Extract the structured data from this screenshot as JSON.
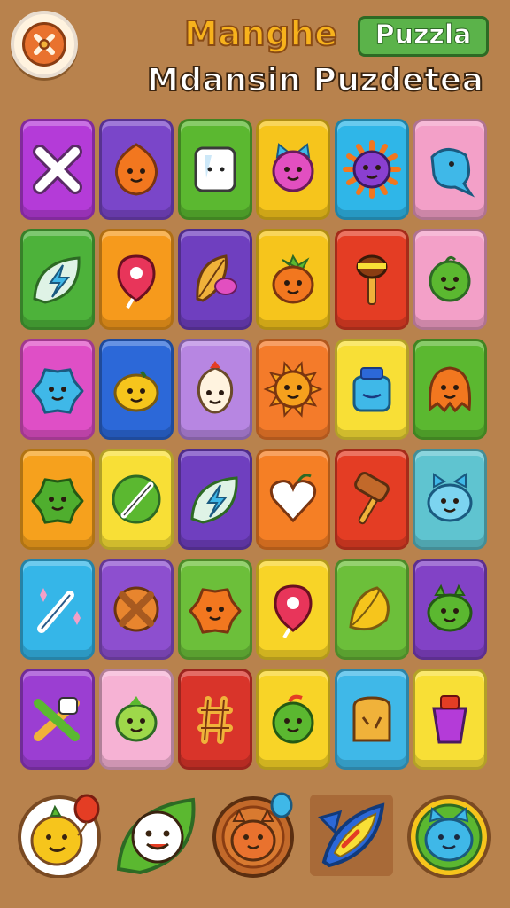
{
  "header": {
    "menu_icon": "paw-icon",
    "title": "Manghe",
    "title_badge": "Puzzla",
    "subtitle": "Mdansin Puzdetea"
  },
  "board": {
    "rows": 6,
    "cols": 6,
    "tiles": [
      [
        {
          "color": "#b43bd8",
          "icon": "cross-bones-icon"
        },
        {
          "color": "#7a46c9",
          "icon": "orange-blob-icon"
        },
        {
          "color": "#5bb830",
          "icon": "white-cube-icon"
        },
        {
          "color": "#f6c51c",
          "icon": "pink-cat-icon"
        },
        {
          "color": "#2fb6e8",
          "icon": "purple-sun-icon"
        },
        {
          "color": "#f3a0c8",
          "icon": "blue-bird-icon"
        }
      ],
      [
        {
          "color": "#4db23a",
          "icon": "lightning-leaf-icon"
        },
        {
          "color": "#f69a1c",
          "icon": "map-pin-icon"
        },
        {
          "color": "#6f3fbf",
          "icon": "leaf-fish-icon"
        },
        {
          "color": "#f6c51c",
          "icon": "orange-fruit-icon"
        },
        {
          "color": "#e43d24",
          "icon": "torch-icon"
        },
        {
          "color": "#f3a0c8",
          "icon": "green-pea-icon"
        }
      ],
      [
        {
          "color": "#df4fc6",
          "icon": "blue-splat-icon"
        },
        {
          "color": "#2c68d8",
          "icon": "lemon-face-icon"
        },
        {
          "color": "#b786e2",
          "icon": "egg-face-icon"
        },
        {
          "color": "#f47b2a",
          "icon": "sun-face-icon"
        },
        {
          "color": "#f8df36",
          "icon": "blue-jar-icon"
        },
        {
          "color": "#5bb830",
          "icon": "orange-monster-icon"
        }
      ],
      [
        {
          "color": "#f6a11d",
          "icon": "green-splat-icon"
        },
        {
          "color": "#f8df36",
          "icon": "pea-pod-icon"
        },
        {
          "color": "#6f3fbf",
          "icon": "lightning-leaf-icon"
        },
        {
          "color": "#f57f25",
          "icon": "heart-icon"
        },
        {
          "color": "#e43d24",
          "icon": "hammer-icon"
        },
        {
          "color": "#5fc4d0",
          "icon": "blue-cat-icon"
        }
      ],
      [
        {
          "color": "#35b6e8",
          "icon": "magic-wand-icon"
        },
        {
          "color": "#8d4fcf",
          "icon": "orange-cross-icon"
        },
        {
          "color": "#6cbf3a",
          "icon": "orange-splat-icon"
        },
        {
          "color": "#f8d427",
          "icon": "map-pin-icon"
        },
        {
          "color": "#6cbf3a",
          "icon": "yellow-leaf-icon"
        },
        {
          "color": "#8242c6",
          "icon": "green-monster-icon"
        }
      ],
      [
        {
          "color": "#9b3ed2",
          "icon": "crossed-sticks-icon"
        },
        {
          "color": "#f6b2d4",
          "icon": "green-bird-icon"
        },
        {
          "color": "#d9342a",
          "icon": "tic-tac-icon"
        },
        {
          "color": "#f8d427",
          "icon": "green-apple-icon"
        },
        {
          "color": "#3fb8e8",
          "icon": "toast-icon"
        },
        {
          "color": "#f8df36",
          "icon": "purple-cup-icon"
        }
      ]
    ]
  },
  "powerups": [
    {
      "icon": "lemon-balloon-icon"
    },
    {
      "icon": "leaf-ghost-icon"
    },
    {
      "icon": "orange-balloon-icon"
    },
    {
      "icon": "rocket-fish-icon"
    },
    {
      "icon": "blue-cat-coin-icon"
    }
  ]
}
